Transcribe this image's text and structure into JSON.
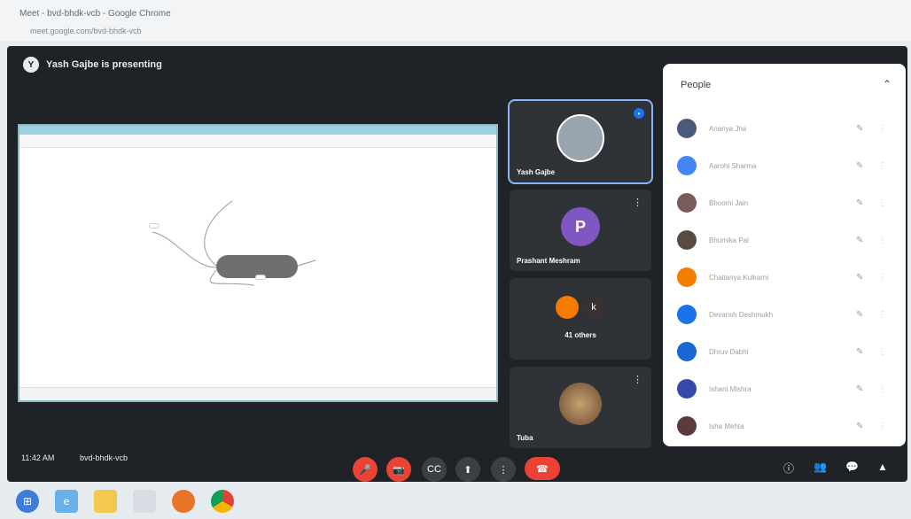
{
  "browser": {
    "tab_title": "Meet - bvd-bhdk-vcb - Google Chrome",
    "url": "meet.google.com/bvd-bhdk-vcb"
  },
  "presenting": {
    "avatar_letter": "Y",
    "label": "Yash Gajbe is presenting"
  },
  "shared_screen": {
    "center_node": "",
    "nodes": [
      "",
      ""
    ]
  },
  "tiles": [
    {
      "name": "Yash Gajbe",
      "badge": "•"
    },
    {
      "name": "Prashant Meshram",
      "avatar_letter": "P",
      "menu": "⋮"
    },
    {
      "others_text": "41 others",
      "others_letter": "k"
    },
    {
      "name": "Tuba",
      "menu": "⋮"
    }
  ],
  "people_panel": {
    "title": "People",
    "close": "⌃",
    "participants": [
      {
        "name": "Ananya Jha",
        "color": "#4a5a7a"
      },
      {
        "name": "Aarohi Sharma",
        "color": "#4285f4"
      },
      {
        "name": "Bhoomi Jain",
        "color": "#7a5a5a"
      },
      {
        "name": "Bhumika Pal",
        "color": "#5a4a40"
      },
      {
        "name": "Chaitanya Kulkarni",
        "color": "#f57c00"
      },
      {
        "name": "Devansh Deshmukh",
        "color": "#1a73e8"
      },
      {
        "name": "Dhruv Dabhi",
        "color": "#1967d2"
      },
      {
        "name": "Ishani Mishra",
        "color": "#3949ab"
      },
      {
        "name": "Isha Mehta",
        "color": "#5a3a3a"
      }
    ]
  },
  "bottom": {
    "time": "11:42 AM",
    "code": "bvd-bhdk-vcb",
    "controls": [
      "🎤",
      "📷",
      "CC",
      "⬆",
      "⋮",
      "☎"
    ],
    "right": [
      "ⓘ",
      "👥",
      "💬",
      "▲"
    ]
  },
  "taskbar": {
    "tray_time": ""
  }
}
